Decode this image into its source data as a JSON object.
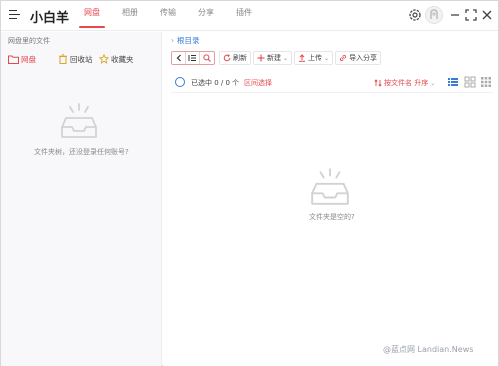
{
  "app": {
    "title": "小白羊"
  },
  "tabs": [
    {
      "label": "网盘",
      "active": true
    },
    {
      "label": "相册",
      "active": false
    },
    {
      "label": "传输",
      "active": false
    },
    {
      "label": "分享",
      "active": false
    },
    {
      "label": "插件",
      "active": false
    }
  ],
  "left": {
    "title": "网盘里的文件",
    "quick": [
      {
        "label": "网盘",
        "icon": "folder-icon",
        "active": true
      },
      {
        "label": "回收站",
        "icon": "recycle-bin-icon",
        "active": false
      },
      {
        "label": "收藏夹",
        "icon": "star-icon",
        "active": false
      }
    ],
    "empty_text": "文件夹树，还没登录任何账号?"
  },
  "right": {
    "breadcrumb": "根目录",
    "toolbar": {
      "refresh": "刷新",
      "new": "新建",
      "upload": "上传",
      "import_share": "导入分享"
    },
    "selection": "已选中 0 / 0 个",
    "range_select": "区间选择",
    "sort": "按文件名 升序",
    "empty_text": "文件夹是空的?"
  },
  "watermark": "@蓝点网 Landian.News",
  "colors": {
    "accent": "#e5484d",
    "link": "#3a7bd5"
  }
}
